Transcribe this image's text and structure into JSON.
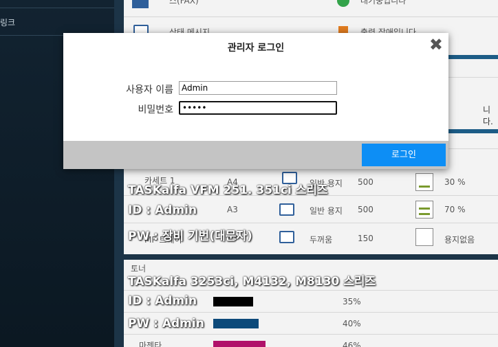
{
  "sidebar": {
    "link_label": "링크"
  },
  "background": {
    "top_items": [
      "스(FAX)",
      "대기중입니다",
      "상태 메시지",
      "출력 장애입니다"
    ],
    "status_text": "니다.",
    "trays": [
      {
        "name": "카세트 1",
        "size": "A4",
        "type": "일반 용지",
        "capacity": "500",
        "level": "30 %"
      },
      {
        "name": "",
        "size": "A3",
        "type": "일반 용지",
        "capacity": "500",
        "level": "70 %"
      },
      {
        "name": "MP 트레이",
        "size": "A3",
        "type": "두꺼움",
        "capacity": "150",
        "level": "용지없음"
      }
    ],
    "toner_header": "토너",
    "toner_rows": [
      {
        "name": "",
        "percent": "35%",
        "color": "#000000",
        "level": 0.35
      },
      {
        "name": "",
        "percent": "40%",
        "color": "#0d4a7a",
        "level": 0.4
      },
      {
        "name": "마젠타",
        "percent": "46%",
        "color": "#b0116a",
        "level": 0.46
      }
    ]
  },
  "captions": {
    "model1": "TASKalfa VFM 251. 351ci 스리즈",
    "id1": "ID : Admin",
    "pw1": "PW : 장비 기번(대문자)",
    "model2": "TASKalfa 3253ci, M4132, M8130 스리즈",
    "id2": "ID : Admin",
    "pw2": "PW : Admin"
  },
  "dialog": {
    "title": "관리자 로그인",
    "close_glyph": "✖",
    "username_label": "사용자 이름",
    "username_value": "Admin",
    "password_label": "비밀번호",
    "password_value": "•••••",
    "login_label": "로그인"
  }
}
